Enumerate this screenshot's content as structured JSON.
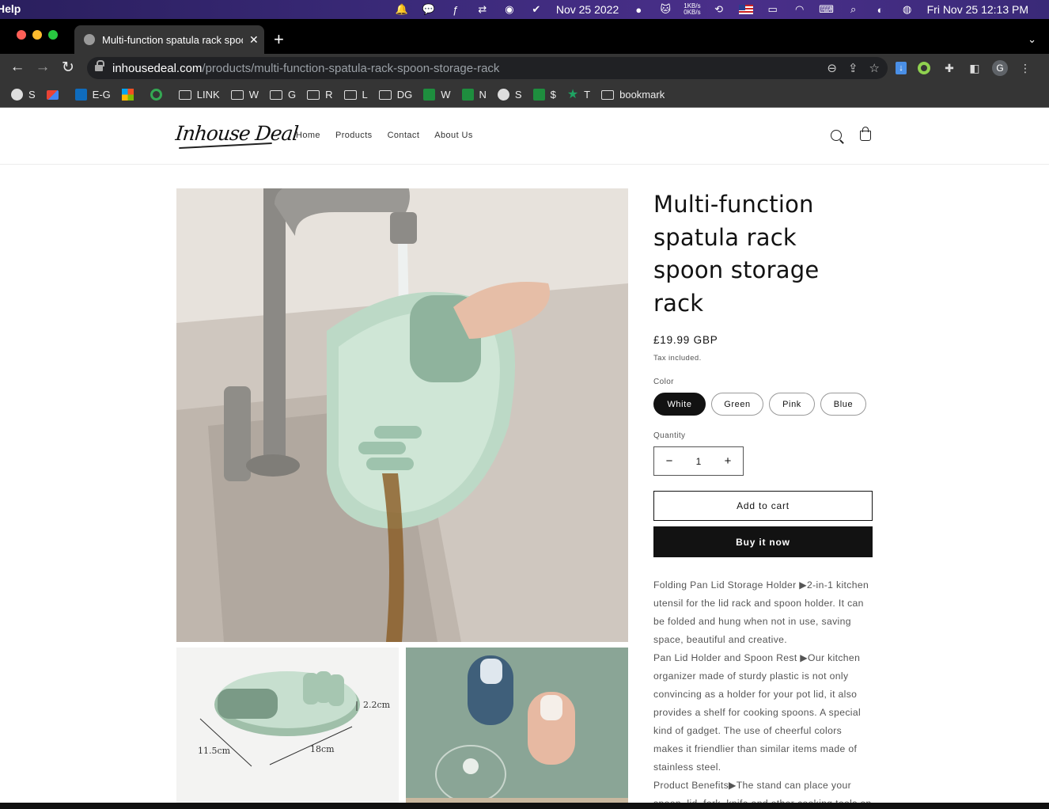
{
  "menubar": {
    "app_menu": "Help",
    "date_short": "Nov 25 2022",
    "net_up": "1KB/s",
    "net_down": "0KB/s",
    "clock": "Fri Nov 25  12:13 PM"
  },
  "browser": {
    "tab_title": "Multi-function spatula rack spoon storage rack",
    "new_tab": "+",
    "tab_close": "✕",
    "url_host": "inhousedeal.com",
    "url_path": "/products/multi-function-spatula-rack-spoon-storage-rack",
    "profile_initial": "G"
  },
  "bookmarks": [
    {
      "icon": "globe-icon",
      "label": "S"
    },
    {
      "icon": "gmail-icon",
      "label": ""
    },
    {
      "icon": "outlook-icon",
      "label": "E-G"
    },
    {
      "icon": "microsoft-icon",
      "label": ""
    },
    {
      "icon": "g-icon",
      "label": ""
    },
    {
      "icon": "folder-icon",
      "label": "LINK"
    },
    {
      "icon": "folder-icon",
      "label": "W"
    },
    {
      "icon": "folder-icon",
      "label": "G"
    },
    {
      "icon": "folder-icon",
      "label": "R"
    },
    {
      "icon": "folder-icon",
      "label": "L"
    },
    {
      "icon": "folder-icon",
      "label": "DG"
    },
    {
      "icon": "cross-icon",
      "label": "W"
    },
    {
      "icon": "cross-icon",
      "label": "N"
    },
    {
      "icon": "globe-icon",
      "label": "S"
    },
    {
      "icon": "cross-icon",
      "label": "$"
    },
    {
      "icon": "star-icon",
      "label": "T"
    },
    {
      "icon": "folder-icon",
      "label": "bookmark"
    }
  ],
  "store": {
    "logo": "Inhouse Deal",
    "nav": [
      "Home",
      "Products",
      "Contact",
      "About Us"
    ]
  },
  "product": {
    "title": "Multi-function spatula rack spoon storage rack",
    "price": "£19.99 GBP",
    "tax_note": "Tax included.",
    "color_label": "Color",
    "colors": [
      "White",
      "Green",
      "Pink",
      "Blue"
    ],
    "selected_color": "White",
    "quantity_label": "Quantity",
    "quantity": "1",
    "decrement": "−",
    "increment": "+",
    "add_to_cart": "Add to cart",
    "buy_now": "Buy it now",
    "description": [
      "Folding Pan Lid Storage Holder ▶2-in-1 kitchen utensil for the lid rack and spoon holder. It can be folded and hung when not in use, saving space, beautiful and creative.",
      "Pan Lid Holder and Spoon Rest ▶Our kitchen organizer made of sturdy plastic is not only convincing as a holder for your pot lid, it also provides a shelf for cooking spoons. A special kind of gadget. The use of cheerful colors makes it friendlier than similar items made of stainless steel.",
      "Product Benefits▶The stand can place your spoon, lid, fork, knife and other cooking tools on it. Raised edges keep spills on, in order to can hold liquids and solids to keep your counter"
    ],
    "dimension_labels": [
      "2.2cm",
      "11.5cm",
      "18cm"
    ]
  }
}
